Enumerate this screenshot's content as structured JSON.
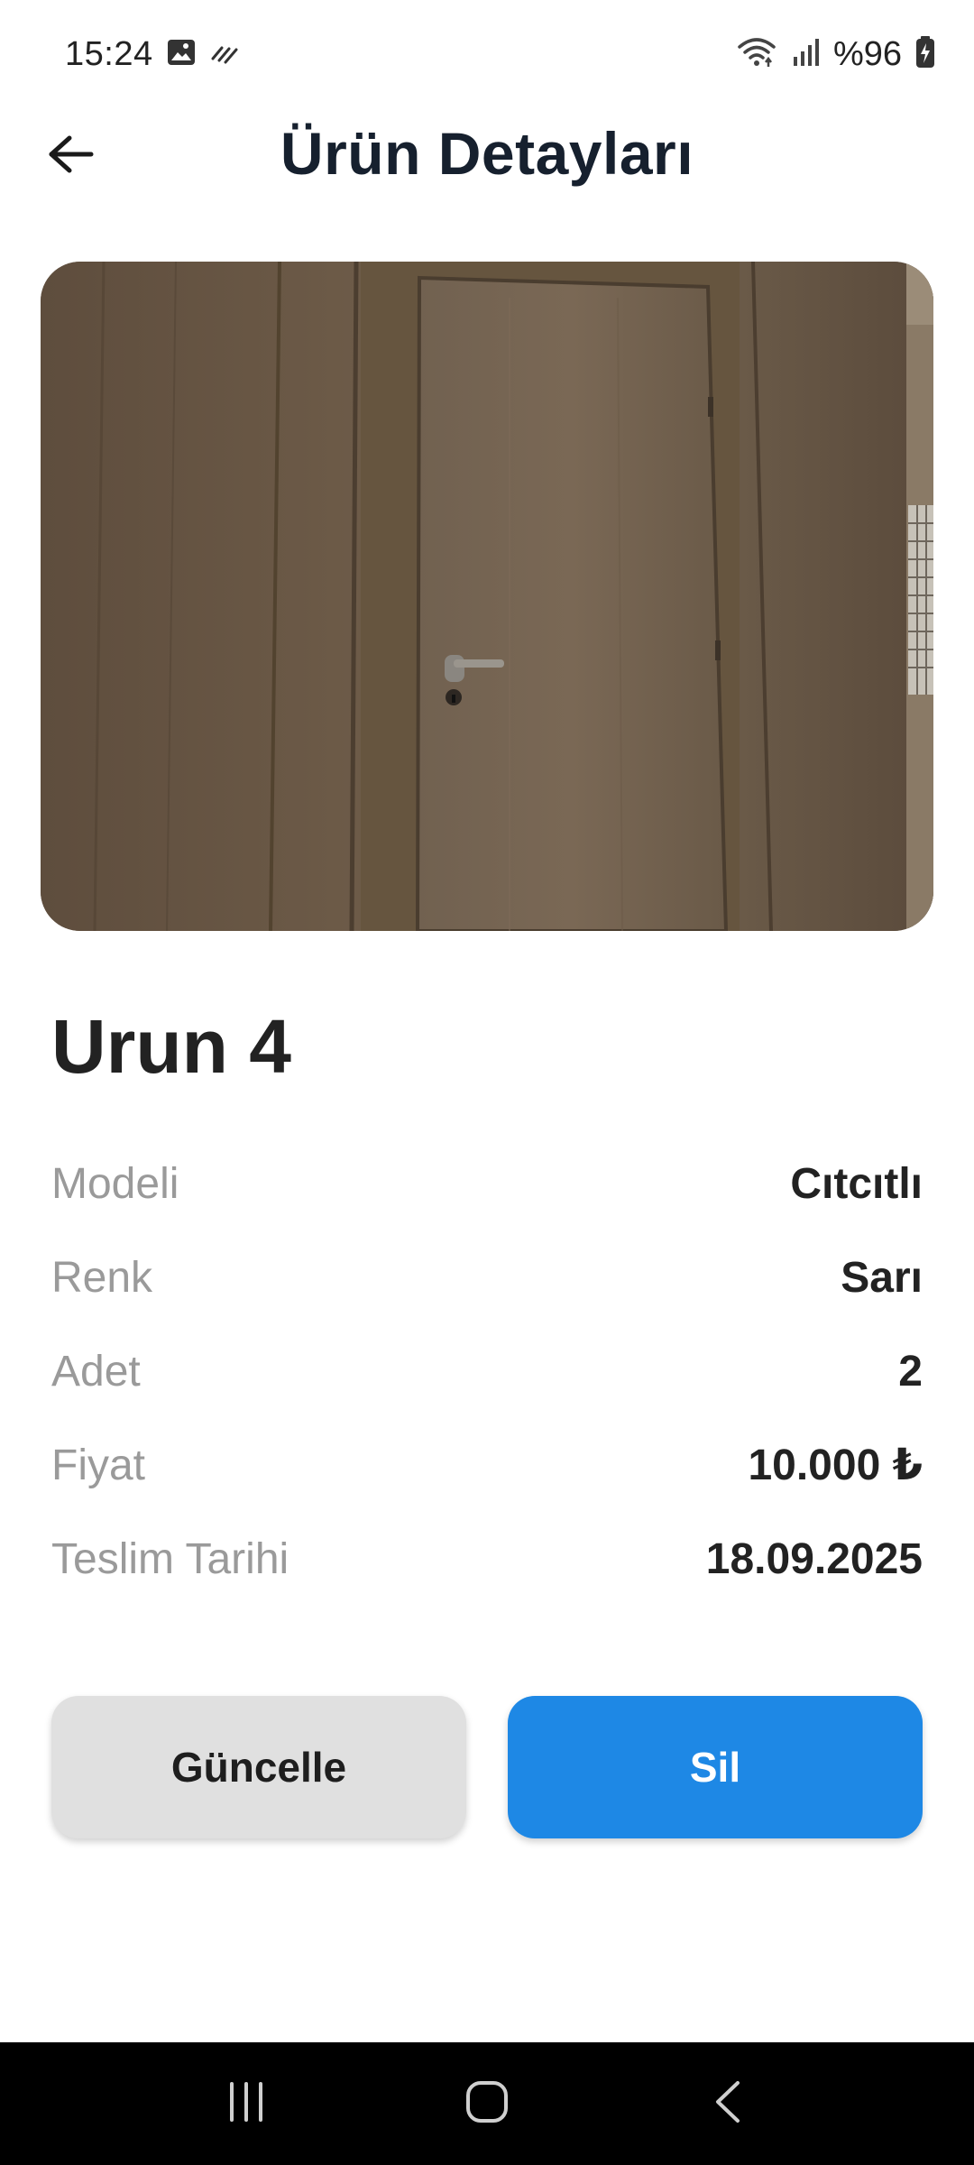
{
  "status_bar": {
    "time": "15:24",
    "battery": "%96",
    "icons": [
      "image-icon",
      "swipe-notification-icon",
      "wifi-icon",
      "signal-icon",
      "battery-charging-icon"
    ]
  },
  "header": {
    "title": "Ürün Detayları",
    "back_icon": "arrow-left-icon"
  },
  "product": {
    "name": "Urun 4",
    "image_description_icon": "door-photo",
    "details": [
      {
        "label": "Modeli",
        "value": "Cıtcıtlı"
      },
      {
        "label": "Renk",
        "value": "Sarı"
      },
      {
        "label": "Adet",
        "value": "2"
      },
      {
        "label": "Fiyat",
        "value": "10.000 ₺"
      },
      {
        "label": "Teslim Tarihi",
        "value": "18.09.2025"
      }
    ]
  },
  "actions": {
    "update_label": "Güncelle",
    "delete_label": "Sil"
  },
  "colors": {
    "accent": "#1e88e5",
    "secondary_button": "#e0e0e0",
    "label_gray": "#9a9a9a",
    "title_dark": "#16202e"
  },
  "nav_bar": {
    "icons": [
      "recent-apps-icon",
      "home-icon",
      "back-icon"
    ]
  }
}
